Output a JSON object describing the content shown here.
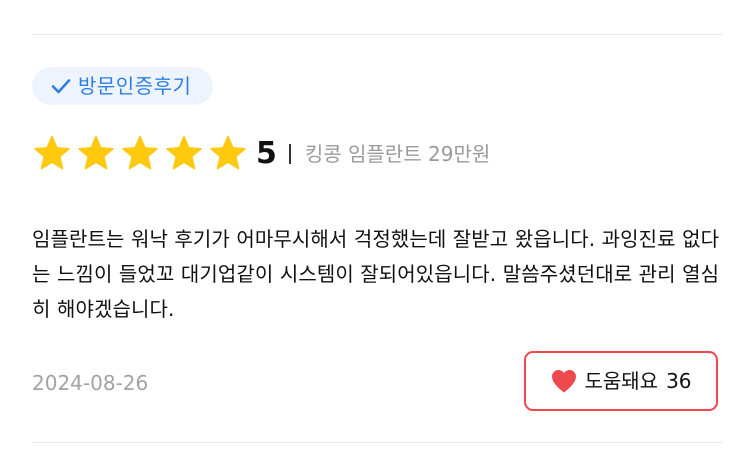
{
  "review": {
    "badge": {
      "icon": "check-icon",
      "label": "방문인증후기",
      "color": "#2e7ee6"
    },
    "rating": {
      "stars": 5,
      "score": "5",
      "star_color": "#ffc90e"
    },
    "product": "킹콩 임플란트 29만원",
    "text": "임플란트는 워낙 후기가 어마무시해서 걱정했는데 잘받고 왔읍니다. 과잉진료 없다는 느낌이 들었꼬 대기업같이 시스템이 잘되어있읍니다. 말씀주셨던대로 관리 열심히 해야겠습니다.",
    "date": "2024-08-26",
    "helpful": {
      "icon": "heart-icon",
      "label": "도움돼요",
      "count": "36",
      "accent": "#f0484f"
    }
  }
}
